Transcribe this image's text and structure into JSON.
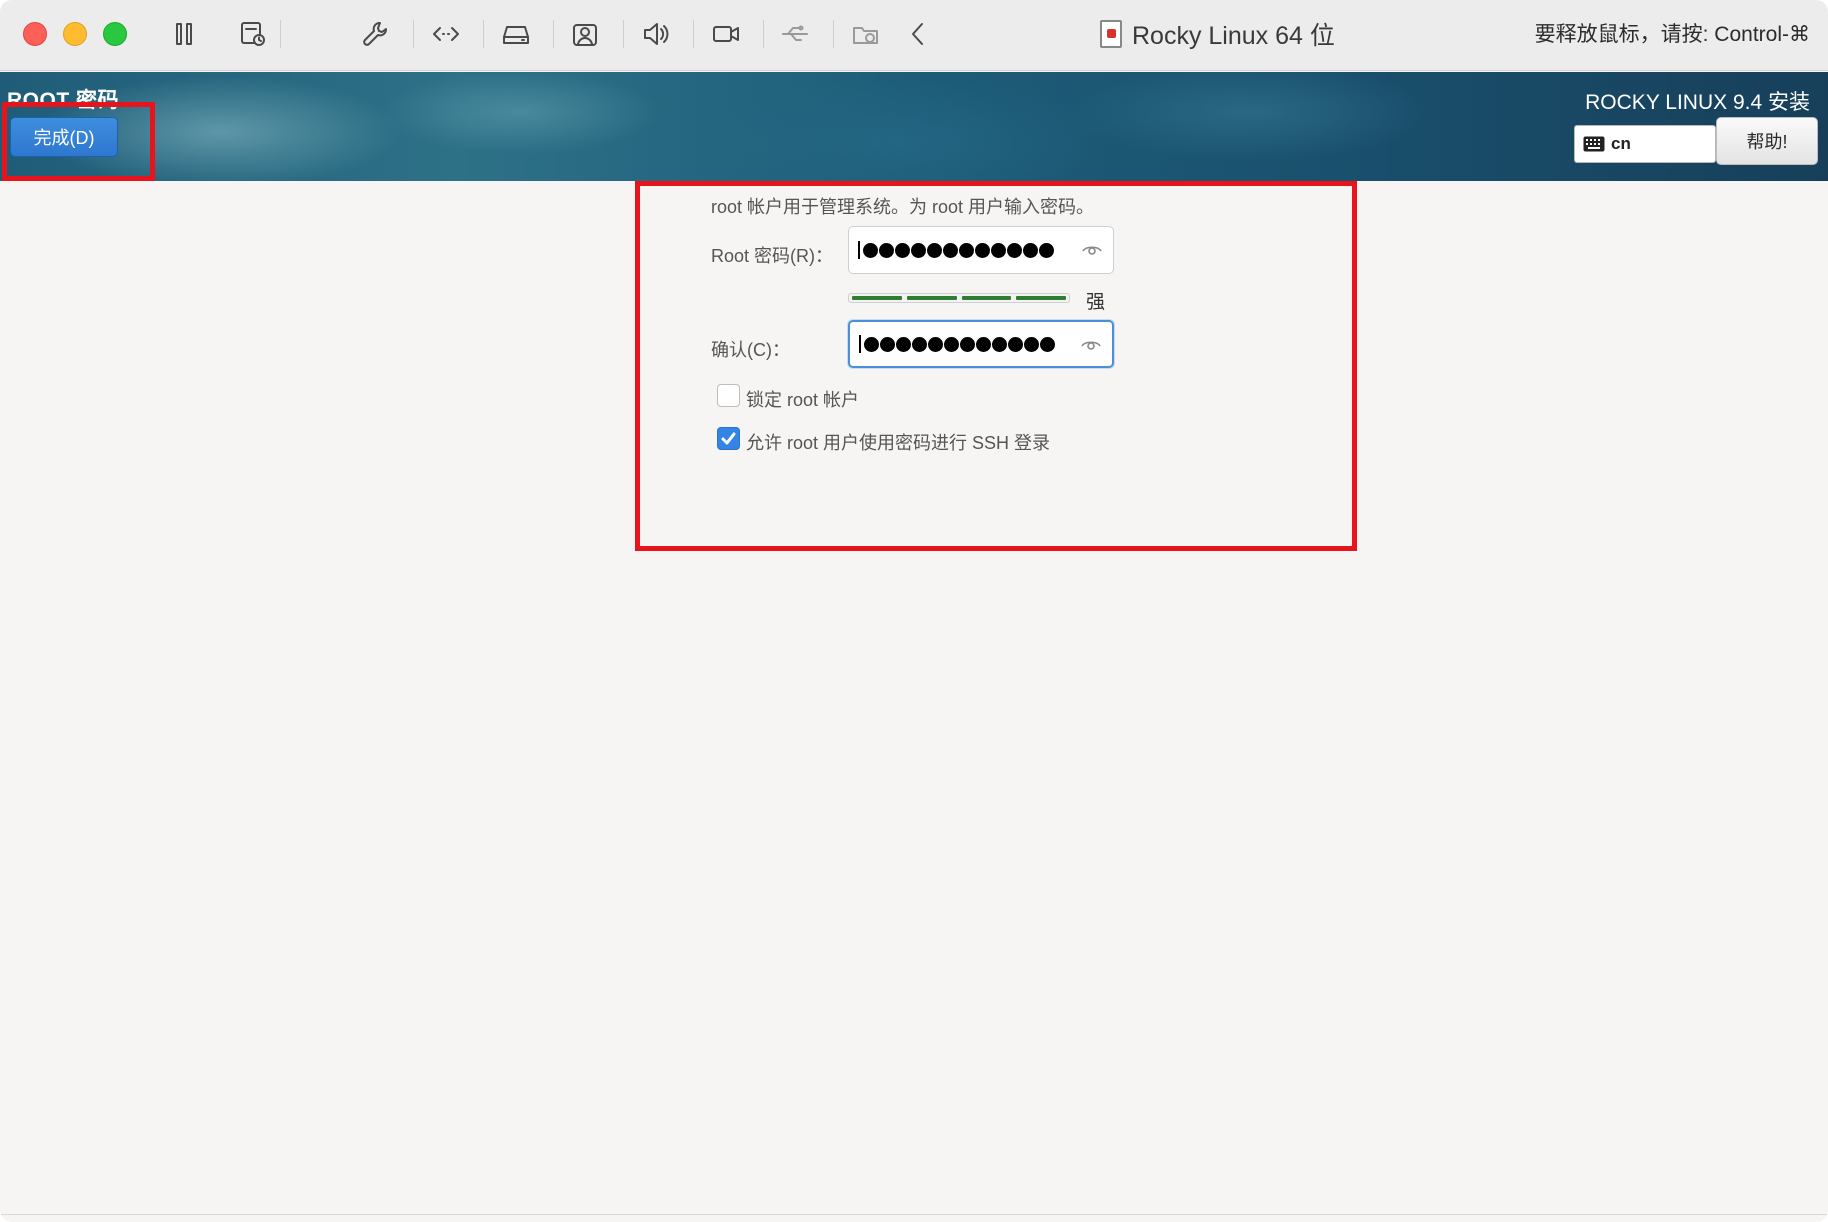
{
  "window": {
    "title": "Rocky Linux 64 位",
    "release_hint": "要释放鼠标，请按: Control-⌘"
  },
  "toolbar": {
    "icons": [
      "pause-icon",
      "snapshot-icon",
      "settings-wrench-icon",
      "code-brackets-icon",
      "disk-icon",
      "user-icon",
      "volume-icon",
      "camera-icon",
      "usb-icon",
      "shared-folder-icon",
      "chevron-left-icon"
    ]
  },
  "header": {
    "spoke_title": "ROOT 密码",
    "done_label": "完成(D)",
    "product": "ROCKY LINUX 9.4 安装",
    "keyboard_layout": "cn",
    "help_label": "帮助!"
  },
  "form": {
    "intro": "root 帐户用于管理系统。为 root 用户输入密码。",
    "password_label": "Root 密码(R)：",
    "confirm_label": "确认(C)：",
    "password_dot_count": 12,
    "strength_text": "强",
    "strength_segments_filled": 4,
    "strength_segments_total": 4,
    "lock_root_label": "锁定 root 帐户",
    "lock_root_checked": false,
    "allow_ssh_label": "允许 root 用户使用密码进行 SSH 登录",
    "allow_ssh_checked": true
  },
  "colors": {
    "accent": "#3584e4",
    "strength_bar": "#2e7d32",
    "highlight": "#e8141b"
  }
}
